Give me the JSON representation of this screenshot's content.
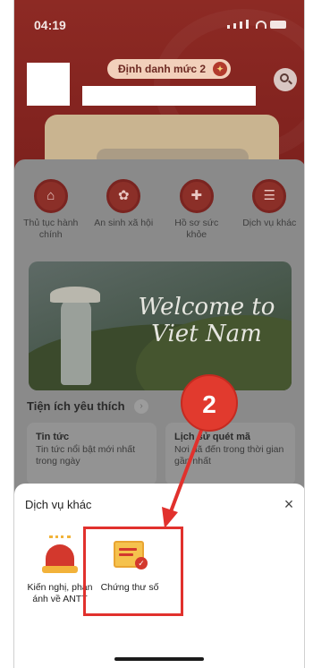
{
  "status_bar": {
    "time": "04:19"
  },
  "header": {
    "level_badge": "Định danh mức 2",
    "level_badge_mark": "✦"
  },
  "services": [
    {
      "label": "Thủ tục hành chính",
      "icon": "building-icon",
      "glyph": "⌂"
    },
    {
      "label": "An sinh xã hội",
      "icon": "social-security-icon",
      "glyph": "✿"
    },
    {
      "label": "Hồ sơ sức khỏe",
      "icon": "health-record-icon",
      "glyph": "✚"
    },
    {
      "label": "Dịch vụ khác",
      "icon": "other-services-icon",
      "glyph": "☰"
    }
  ],
  "banner": {
    "line1": "Welcome to",
    "line2": "Viet Nam"
  },
  "favorites": {
    "title": "Tiện ích yêu thích",
    "arrow": "›",
    "cards": [
      {
        "title": "Tin tức",
        "desc": "Tin tức nổi bật mới nhất trong ngày"
      },
      {
        "title": "Lịch sử quét mã",
        "desc": "Nơi đã đến trong thời gian gần nhất"
      }
    ]
  },
  "sheet": {
    "title": "Dịch vụ khác",
    "close": "×",
    "items": [
      {
        "label": "Kiến nghị, phản ánh về ANTT",
        "icon": "alarm-icon"
      },
      {
        "label": "Chứng thư số",
        "icon": "certificate-icon"
      }
    ]
  },
  "annotation": {
    "step": "2"
  },
  "colors": {
    "accent_red": "#e1312d",
    "header_red": "#8d2a24",
    "cert_gold": "#f5c24d"
  }
}
